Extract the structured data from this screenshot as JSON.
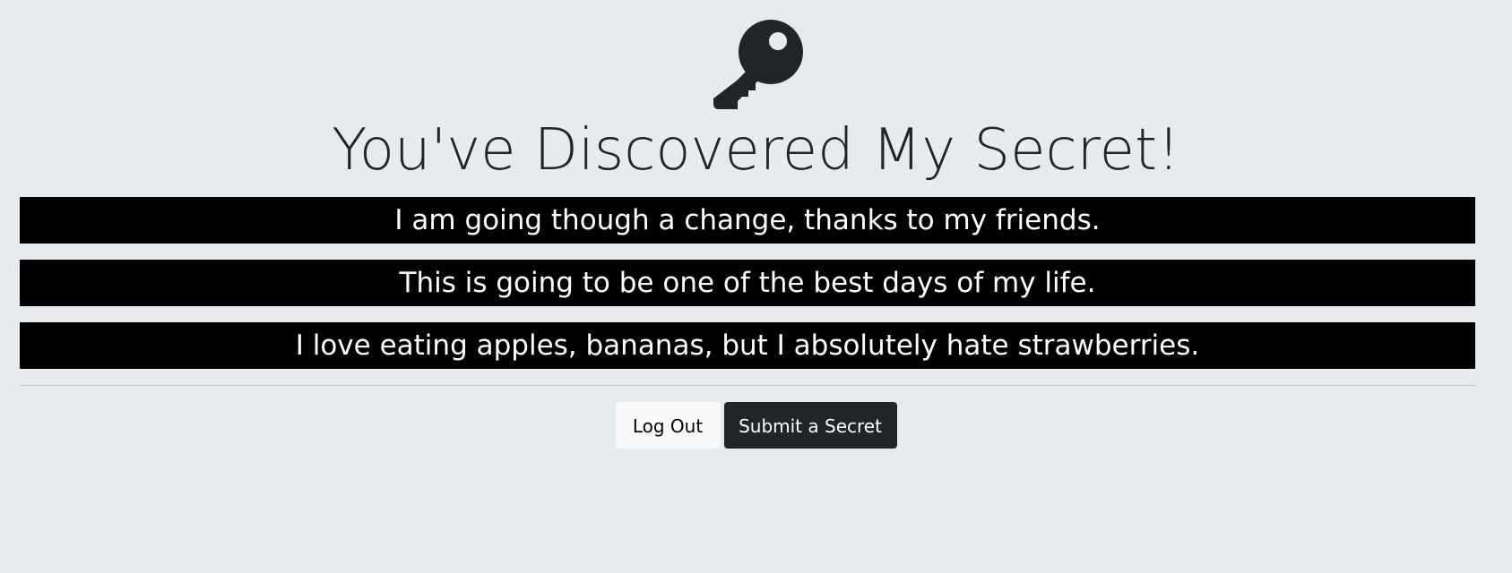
{
  "header": {
    "icon": "key-icon",
    "title": "You've Discovered My Secret!"
  },
  "secrets": [
    "I am going though a change, thanks to my friends.",
    "This is going to be one of the best days of my life.",
    "I love eating apples, bananas, but I absolutely hate strawberries."
  ],
  "actions": {
    "logout_label": "Log Out",
    "submit_label": "Submit a Secret"
  },
  "colors": {
    "background": "#e8ebee",
    "secret_bar": "#000000",
    "secret_text": "#ffffff",
    "title_text": "#212529",
    "button_light": "#f8f9fa",
    "button_dark": "#212529"
  }
}
